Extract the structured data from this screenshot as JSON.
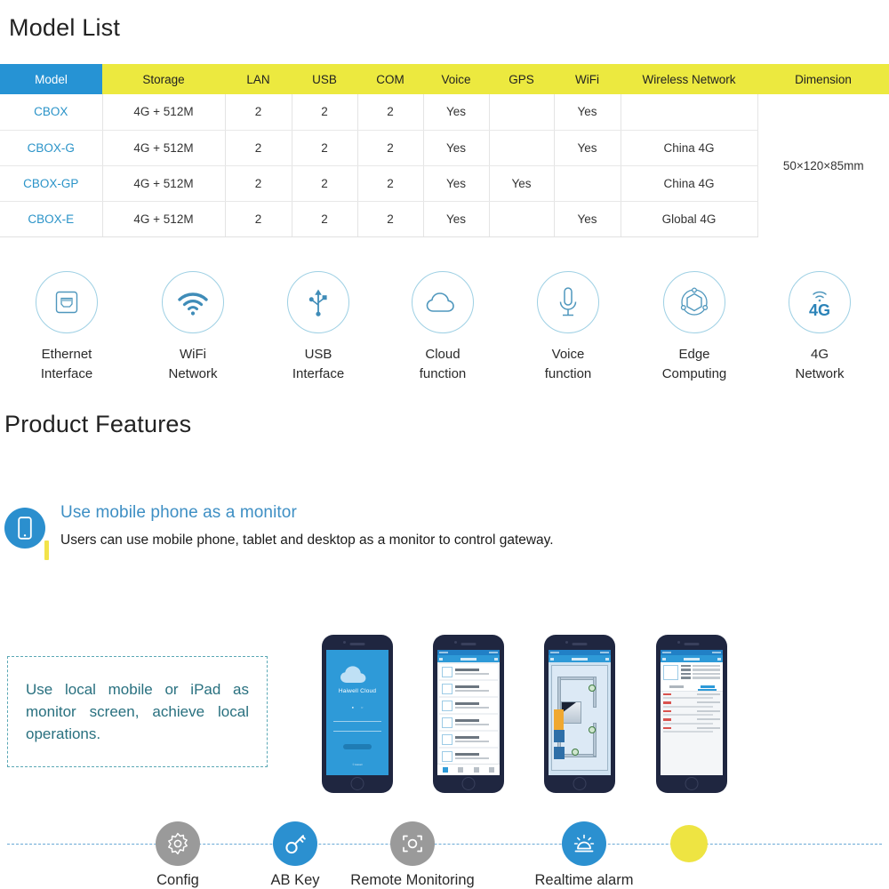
{
  "sections": {
    "model_list_title": "Model List",
    "product_features_title": "Product Features"
  },
  "table": {
    "columns": [
      "Model",
      "Storage",
      "LAN",
      "USB",
      "COM",
      "Voice",
      "GPS",
      "WiFi",
      "Wireless Network",
      "Dimension"
    ],
    "rows": [
      {
        "model": "CBOX",
        "storage": "4G + 512M",
        "lan": "2",
        "usb": "2",
        "com": "2",
        "voice": "Yes",
        "gps": "",
        "wifi": "Yes",
        "wireless": ""
      },
      {
        "model": "CBOX-G",
        "storage": "4G + 512M",
        "lan": "2",
        "usb": "2",
        "com": "2",
        "voice": "Yes",
        "gps": "",
        "wifi": "Yes",
        "wireless": "China 4G"
      },
      {
        "model": "CBOX-GP",
        "storage": "4G + 512M",
        "lan": "2",
        "usb": "2",
        "com": "2",
        "voice": "Yes",
        "gps": "Yes",
        "wifi": "",
        "wireless": "China 4G"
      },
      {
        "model": "CBOX-E",
        "storage": "4G + 512M",
        "lan": "2",
        "usb": "2",
        "com": "2",
        "voice": "Yes",
        "gps": "",
        "wifi": "Yes",
        "wireless": "Global 4G"
      }
    ],
    "dimension_value": "50×120×85mm",
    "header_bg": "#ece93f",
    "model_header_bg": "#2693d4",
    "model_text_color": "#2a93c8"
  },
  "feature_icons": [
    {
      "icon": "ethernet-port-icon",
      "line1": "Ethernet",
      "line2": "Interface"
    },
    {
      "icon": "wifi-icon",
      "line1": "WiFi",
      "line2": "Network"
    },
    {
      "icon": "usb-icon",
      "line1": "USB",
      "line2": "Interface"
    },
    {
      "icon": "cloud-icon",
      "line1": "Cloud",
      "line2": "function"
    },
    {
      "icon": "microphone-icon",
      "line1": "Voice",
      "line2": "function"
    },
    {
      "icon": "edge-computing-icon",
      "line1": "Edge",
      "line2": "Computing"
    },
    {
      "icon": "4g-signal-icon",
      "line1": "4G",
      "line2": "Network"
    }
  ],
  "feature_bullet": {
    "icon": "mobile-phone-icon",
    "title": "Use mobile phone as a monitor",
    "description": "Users can use mobile phone, tablet and desktop as a monitor to control gateway."
  },
  "callout": {
    "text": "Use local mobile or iPad as monitor screen, achieve local operations."
  },
  "phones": [
    {
      "name": "cloud-login-screen",
      "brand": "Haiwell Cloud"
    },
    {
      "name": "device-list-screen"
    },
    {
      "name": "hmi-diagram-screen"
    },
    {
      "name": "alarm-detail-screen"
    }
  ],
  "timeline": [
    {
      "icon": "gear-icon",
      "label": "Config",
      "color": "gray"
    },
    {
      "icon": "key-icon",
      "label": "AB Key",
      "color": "blue"
    },
    {
      "icon": "camera-focus-icon",
      "label": "Remote Monitoring",
      "color": "gray"
    },
    {
      "icon": "alarm-sunrise-icon",
      "label": "Realtime alarm",
      "color": "blue"
    },
    {
      "icon": "dot-icon",
      "label": "",
      "color": "yellow"
    }
  ],
  "colors": {
    "accent_blue": "#2b90d0",
    "accent_yellow": "#ece93f",
    "icon_outline": "#4f97bd",
    "teal": "#28707f"
  }
}
